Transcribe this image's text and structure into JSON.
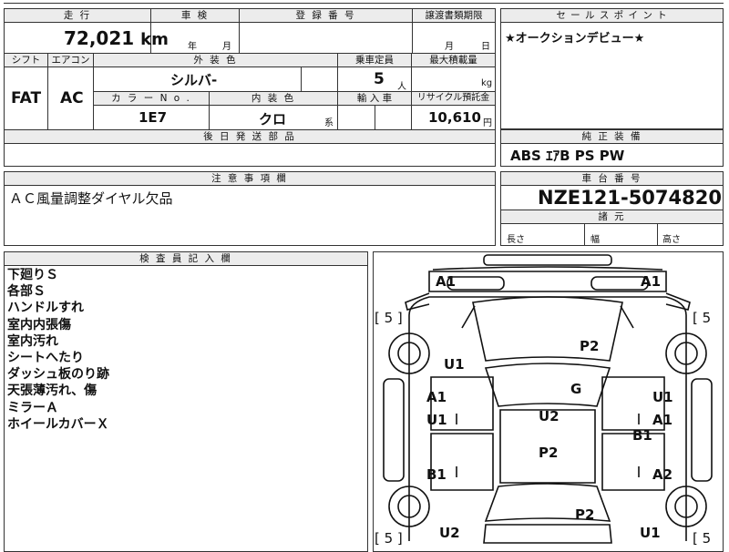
{
  "header": {
    "mileage_label": "走 行",
    "inspection_label": "車 検",
    "reg_no_label": "登 録 番 号",
    "transfer_docs_label": "譲渡書類期限",
    "sales_point_label": "セ ー ル ス ポ イ ン ト"
  },
  "values": {
    "mileage": "72,021",
    "mileage_unit": "km",
    "inspection_year_unit": "年",
    "inspection_month_unit": "月",
    "transfer_month_unit": "月",
    "transfer_day_unit": "日",
    "sales_point": "★オークションデビュー★"
  },
  "row2": {
    "shift_label": "シフト",
    "aircon_label": "エアコン",
    "exterior_color_label": "外 装 色",
    "capacity_label": "乗車定員",
    "max_load_label": "最大積載量",
    "shift": "FAT",
    "aircon": "AC",
    "exterior_color": "シルバ-",
    "capacity": "5",
    "capacity_unit": "人",
    "load_unit": "kg",
    "color_no_label": "カ ラ ー N o .",
    "interior_color_label": "内 装 色",
    "import_label": "輸 入 車",
    "recycle_label": "リサイクル預託金",
    "color_no": "1E7",
    "interior_color": "クロ",
    "interior_suffix": "系",
    "recycle_fee": "10,610",
    "recycle_unit": "円",
    "later_parts_label": "後 日 発 送 部 品"
  },
  "equipment": {
    "label": "純 正 装 備",
    "value": "ABS ｴｱB PS PW"
  },
  "notes": {
    "label": "注 意 事 項 欄",
    "value": "ＡＣ風量調整ダイヤル欠品"
  },
  "chassis": {
    "label": "車 台 番 号",
    "value": "NZE121-5074820",
    "specs_label": "諸 元",
    "length_label": "長さ",
    "width_label": "幅",
    "height_label": "高さ"
  },
  "inspector": {
    "label": "検 査 員 記 入 欄",
    "lines": [
      "下廻りＳ",
      "各部Ｓ",
      "ハンドルすれ",
      "室内内張傷",
      "室内汚れ",
      "シートへたり",
      "ダッシュ板のり跡",
      "天張薄汚れ、傷",
      "ミラーＡ",
      "ホイールカバーＸ"
    ]
  },
  "diagram": {
    "tire_left_top": "[ 5 ]",
    "tire_right_top": "[ 5",
    "tire_left_bottom": "[ 5 ]",
    "tire_right_bottom": "[ 5",
    "marks": {
      "a1_tl": "A1",
      "a1_tr": "A1",
      "p2_hood": "P2",
      "u1_left_front": "U1",
      "g_windshield": "G",
      "a1_lf": "A1",
      "u1_lf": "U1",
      "u1_rf": "U1",
      "a1_rf": "A1",
      "u2_roof": "U2",
      "b1_right": "B1",
      "p2_rear": "P2",
      "b1_left": "B1",
      "a2_right": "A2",
      "p2_trunk": "P2",
      "u2_bl": "U2",
      "u1_br": "U1"
    }
  }
}
